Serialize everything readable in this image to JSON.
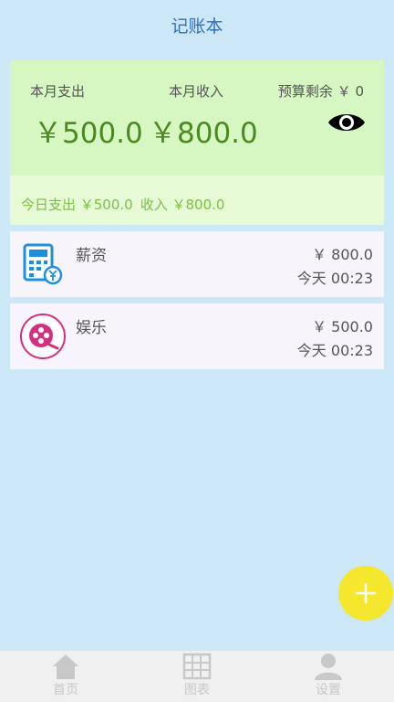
{
  "header": {
    "title": "记账本"
  },
  "summary": {
    "expense_label": "本月支出",
    "income_label": "本月收入",
    "budget_label": "预算剩余 ￥ 0",
    "expense_amount": "￥500.0",
    "income_amount": "￥800.0",
    "today_expense": "今日支出 ￥500.0",
    "today_income": "收入 ￥800.0",
    "colors": {
      "card": "#d7f7c2",
      "accent": "#4b8a1e"
    }
  },
  "records": [
    {
      "name": "薪资",
      "amount": "￥ 800.0",
      "time": "今天 00:23",
      "icon": "salary-calculator-icon"
    },
    {
      "name": "娱乐",
      "amount": "￥ 500.0",
      "time": "今天 00:23",
      "icon": "entertainment-film-icon"
    }
  ],
  "fab": {
    "icon": "plus-icon"
  },
  "tabs": [
    {
      "label": "首页",
      "icon": "home-icon"
    },
    {
      "label": "图表",
      "icon": "chart-grid-icon"
    },
    {
      "label": "设置",
      "icon": "user-icon"
    }
  ]
}
